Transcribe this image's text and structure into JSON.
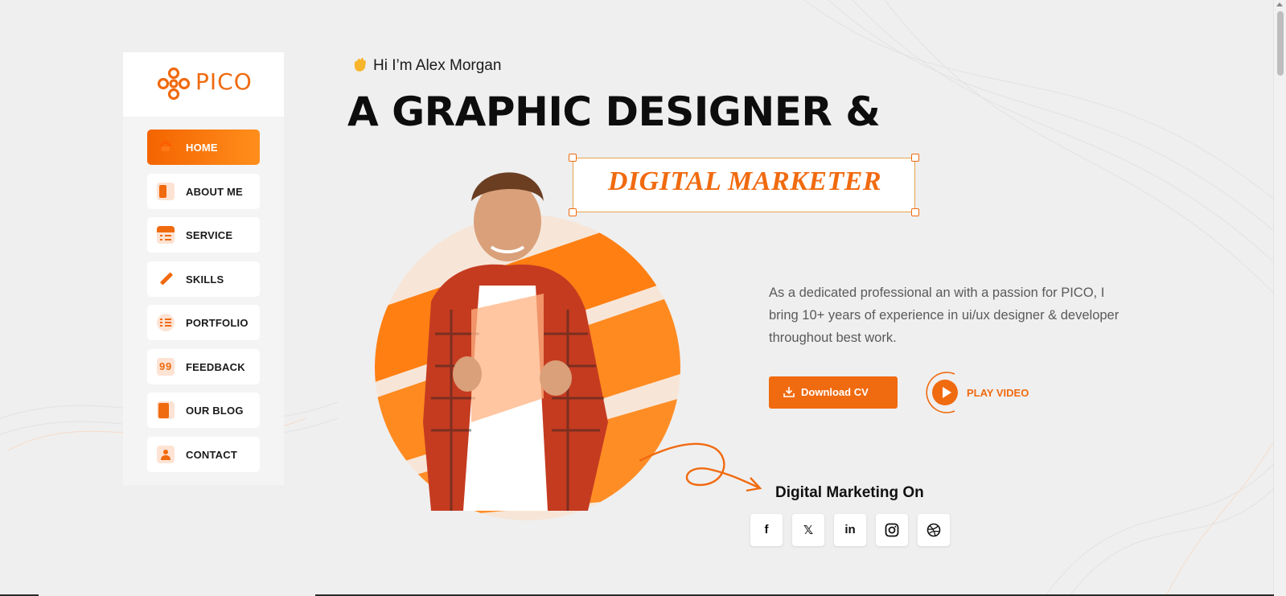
{
  "brand": {
    "name": "PICO",
    "accent": "#f06a0f"
  },
  "nav": {
    "items": [
      {
        "label": "HOME",
        "icon": "home-icon",
        "active": true
      },
      {
        "label": "ABOUT ME",
        "icon": "profile-icon"
      },
      {
        "label": "SERVICE",
        "icon": "service-list-icon"
      },
      {
        "label": "SKILLS",
        "icon": "pen-icon"
      },
      {
        "label": "PORTFOLIO",
        "icon": "portfolio-list-icon"
      },
      {
        "label": "FEEDBACK",
        "icon": "quote-icon"
      },
      {
        "label": "OUR BLOG",
        "icon": "blog-icon"
      },
      {
        "label": "CONTACT",
        "icon": "contact-person-icon"
      }
    ]
  },
  "hero": {
    "greeting": "Hi I’m Alex Morgan",
    "greeting_icon": "waving-hand-icon",
    "headline": "A GRAPHIC DESIGNER &",
    "role": "DIGITAL MARKETER",
    "description": "As a dedicated professional an with a passion for PICO, I bring 10+ years of experience in ui/ux designer & developer throughout best work.",
    "download_cv_label": "Download CV",
    "play_video_label": "PLAY VIDEO"
  },
  "social": {
    "title": "Digital Marketing On",
    "items": [
      {
        "name": "facebook-icon",
        "glyph": "f"
      },
      {
        "name": "x-twitter-icon",
        "glyph": "𝕏"
      },
      {
        "name": "linkedin-icon",
        "glyph": "in"
      },
      {
        "name": "instagram-icon",
        "glyph": ""
      },
      {
        "name": "dribbble-icon",
        "glyph": ""
      }
    ]
  }
}
